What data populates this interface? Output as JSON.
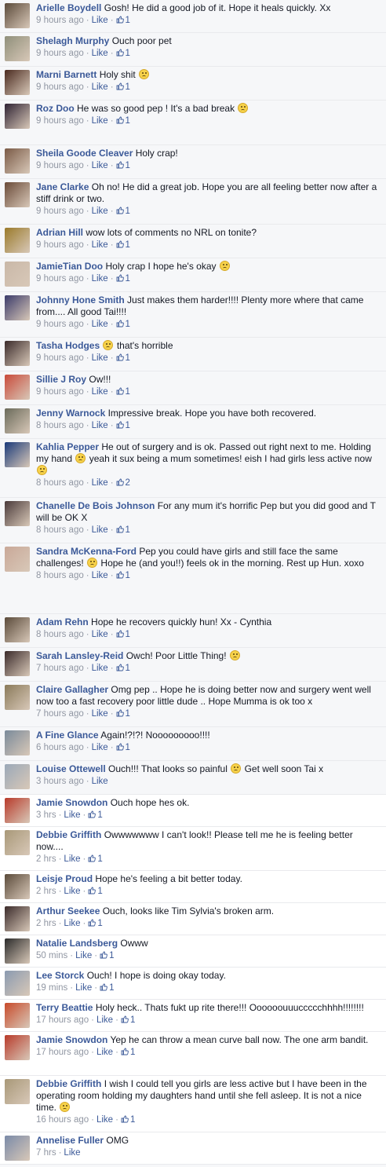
{
  "comments": [
    {
      "name": "Arielle Boydell",
      "text": "Gosh! He did a good job of it. Hope it heals quickly. Xx",
      "time": "9 hours ago",
      "like": "Like",
      "likes": "1",
      "emoji": false,
      "avatar_color": "#5b4a3a",
      "h": 42
    },
    {
      "name": "Shelagh Murphy",
      "text": "Ouch poor pet",
      "time": "9 hours ago",
      "like": "Like",
      "likes": "1",
      "emoji": false,
      "avatar_color": "#8f8f7a",
      "h": 43
    },
    {
      "name": "Marni Barnett",
      "text": "Holy shit",
      "time": "9 hours ago",
      "like": "Like",
      "likes": "1",
      "emoji": true,
      "avatar_color": "#4a2a1f",
      "h": 43
    },
    {
      "name": "Roz Doo",
      "text": "He was so good pep ! It's a bad break",
      "time": "9 hours ago",
      "like": "Like",
      "likes": "1",
      "emoji": true,
      "avatar_color": "#2e2233",
      "h": 57
    },
    {
      "name": "Sheila Goode Cleaver",
      "text": "Holy crap!",
      "time": "9 hours ago",
      "like": "Like",
      "likes": "1",
      "emoji": false,
      "avatar_color": "#7a5a46",
      "h": 43
    },
    {
      "name": "Jane Clarke",
      "text": "Oh no! He did a great job. Hope you are all feeling better now after a stiff drink or two.",
      "time": "9 hours ago",
      "like": "Like",
      "likes": "1",
      "emoji": false,
      "avatar_color": "#6a4a38",
      "h": 58
    },
    {
      "name": "Adrian Hill",
      "text": "wow lots of comments no NRL on tonite?",
      "time": "9 hours ago",
      "like": "Like",
      "likes": "1",
      "emoji": false,
      "avatar_color": "#9a7a2a",
      "h": 43
    },
    {
      "name": "JamieTian Doo",
      "text": "Holy crap I hope he's okay",
      "time": "9 hours ago",
      "like": "Like",
      "likes": "1",
      "emoji": true,
      "avatar_color": "#c9b8a8",
      "h": 43
    },
    {
      "name": "Johnny Hone Smith",
      "text": "Just makes them harder!!!! Plenty more where that came from.... All good Tai!!!!",
      "time": "9 hours ago",
      "like": "Like",
      "likes": "1",
      "emoji": false,
      "avatar_color": "#3a3a6a",
      "h": 58
    },
    {
      "name": "Tasha Hodges",
      "text": "that's horrible",
      "time": "9 hours ago",
      "like": "Like",
      "likes": "1",
      "emoji": true,
      "emoji_first": true,
      "avatar_color": "#3a2a2a",
      "h": 43
    },
    {
      "name": "Sillie J Roy",
      "text": "Ow!!!",
      "time": "9 hours ago",
      "like": "Like",
      "likes": "1",
      "emoji": false,
      "avatar_color": "#c94a3a",
      "h": 43
    },
    {
      "name": "Jenny Warnock",
      "text": "Impressive break. Hope you have both recovered.",
      "time": "8 hours ago",
      "like": "Like",
      "likes": "1",
      "emoji": false,
      "avatar_color": "#6a6a5a",
      "h": 43
    },
    {
      "name": "Kahlia Pepper",
      "text": "He out of surgery and is ok. Passed out right next to me. Holding my hand",
      "text2": "yeah it sux being a mum sometimes! eish I had girls less active now",
      "time": "8 hours ago",
      "like": "Like",
      "likes": "2",
      "emoji": true,
      "emoji_mid": true,
      "emoji_end": true,
      "avatar_color": "#1a3a7a",
      "h": 75
    },
    {
      "name": "Chanelle De Bois Johnson",
      "text": "For any mum it's horrific Pep but you did good and T will be OK X",
      "time": "8 hours ago",
      "like": "Like",
      "likes": "1",
      "emoji": false,
      "avatar_color": "#4a3a3a",
      "h": 58
    },
    {
      "name": "Sandra McKenna-Ford",
      "text": "Pep you could have girls and still face the same challenges!",
      "text2": "Hope he (and you!!) feels ok in the morning. Rest up Hun. xoxo",
      "time": "8 hours ago",
      "like": "Like",
      "likes": "1",
      "emoji": true,
      "emoji_mid": true,
      "avatar_color": "#c9a898",
      "h": 90
    },
    {
      "name": "Adam Rehn",
      "text": "Hope he recovers quickly hun! Xx - Cynthia",
      "time": "8 hours ago",
      "like": "Like",
      "likes": "1",
      "emoji": false,
      "avatar_color": "#5a4a3a",
      "h": 43
    },
    {
      "name": "Sarah Lansley-Reid",
      "text": "Owch! Poor Little Thing!",
      "time": "7 hours ago",
      "like": "Like",
      "likes": "1",
      "emoji": true,
      "avatar_color": "#3a2a2a",
      "h": 43
    },
    {
      "name": "Claire Gallagher",
      "text": "Omg pep .. Hope he is doing better now and surgery went well now too a fast recovery poor little dude .. Hope Mumma is ok too x",
      "time": "7 hours ago",
      "like": "Like",
      "likes": "1",
      "emoji": false,
      "avatar_color": "#8a7a5a",
      "h": 58
    },
    {
      "name": "A Fine Glance",
      "text": "Again!?!?! Nooooooooo!!!!",
      "time": "6 hours ago",
      "like": "Like",
      "likes": "1",
      "emoji": false,
      "avatar_color": "#7a8a9a",
      "h": 43
    },
    {
      "name": "Louise Ottewell",
      "text": "Ouch!!! That looks so painful",
      "text2": "Get well soon Tai x",
      "time": "3 hours ago",
      "like": "Like",
      "likes": "",
      "emoji": true,
      "emoji_mid": true,
      "avatar_color": "#9aa8b8",
      "h": 43
    },
    {
      "name": "Jamie Snowdon",
      "text": "Ouch hope hes ok.",
      "time": "3 hrs",
      "like": "Like",
      "likes": "1",
      "emoji": false,
      "avatar_color": "#b83a2a",
      "h": 41
    },
    {
      "name": "Debbie Griffith",
      "text": "Owwwwwww I can't look!! Please tell me he is feeling better now....",
      "time": "2 hrs",
      "like": "Like",
      "likes": "1",
      "emoji": false,
      "avatar_color": "#a89878",
      "h": 56
    },
    {
      "name": "Leisje Proud",
      "text": "Hope he's feeling a bit better today.",
      "time": "2 hrs",
      "like": "Like",
      "likes": "1",
      "emoji": false,
      "avatar_color": "#5a4a3a",
      "h": 41
    },
    {
      "name": "Arthur Seekee",
      "text": "Ouch, looks like Tim Sylvia's broken arm.",
      "time": "2 hrs",
      "like": "Like",
      "likes": "1",
      "emoji": false,
      "avatar_color": "#3a2a2a",
      "h": 41
    },
    {
      "name": "Natalie Landsberg",
      "text": "Owww",
      "time": "50 mins",
      "like": "Like",
      "likes": "1",
      "emoji": false,
      "avatar_color": "#2a2a2a",
      "h": 41
    },
    {
      "name": "Lee Storck",
      "text": "Ouch! I hope is doing okay today.",
      "time": "19 mins",
      "like": "Like",
      "likes": "1",
      "emoji": false,
      "avatar_color": "#8a9ab0",
      "h": 41
    },
    {
      "name": "Terry Beattie",
      "text": "Holy heck.. Thats fukt up rite there!!! Oooooouuuccccchhhh!!!!!!!!",
      "time": "17 hours ago",
      "like": "Like",
      "likes": "1",
      "emoji": false,
      "avatar_color": "#c84a2a",
      "h": 41
    },
    {
      "name": "Jamie Snowdon",
      "text": "Yep he can throw a mean curve ball now. The one arm bandit.",
      "time": "17 hours ago",
      "like": "Like",
      "likes": "1",
      "emoji": false,
      "avatar_color": "#b83a2a",
      "h": 56
    },
    {
      "name": "Debbie Griffith",
      "text": "I wish I could tell you girls are less active but I have been in the operating room holding my daughters hand until she fell asleep. It is not a nice time.",
      "time": "16 hours ago",
      "like": "Like",
      "likes": "1",
      "emoji": true,
      "avatar_color": "#a89878",
      "h": 72
    },
    {
      "name": "Annelise Fuller",
      "text": "OMG",
      "time": "7 hrs",
      "like": "Like",
      "likes": "",
      "emoji": false,
      "avatar_color": "#7a8aa8",
      "h": 41
    }
  ]
}
